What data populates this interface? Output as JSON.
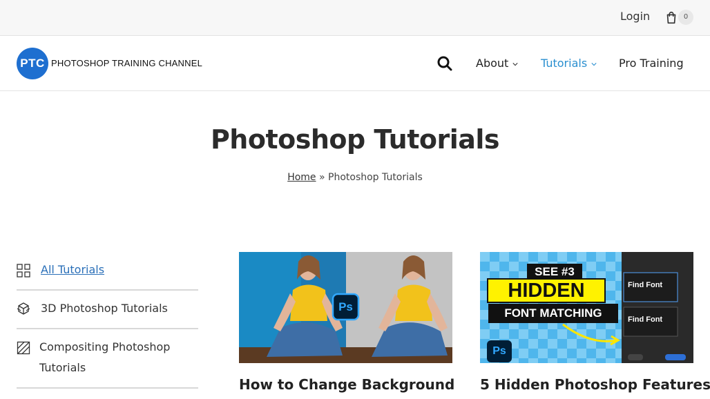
{
  "topbar": {
    "login": "Login",
    "cart_count": "0"
  },
  "header": {
    "logo_mark": "PTC",
    "logo_text": "PHOTOSHOP TRAINING CHANNEL",
    "nav": [
      {
        "label": "About",
        "has_dropdown": true
      },
      {
        "label": "Tutorials",
        "has_dropdown": true,
        "active": true
      },
      {
        "label": "Pro Training",
        "has_dropdown": false
      }
    ]
  },
  "page": {
    "title": "Photoshop Tutorials",
    "breadcrumb_home": "Home",
    "breadcrumb_sep": "»",
    "breadcrumb_current": "Photoshop Tutorials"
  },
  "sidebar": {
    "items": [
      {
        "label": "All Tutorials",
        "icon": "grid-icon",
        "active": true
      },
      {
        "label": "3D Photoshop Tutorials",
        "icon": "cube-icon"
      },
      {
        "label": "Compositing Photoshop Tutorials",
        "icon": "compositing-icon"
      }
    ]
  },
  "cards": [
    {
      "title": "How to Change Background",
      "thumb_badge": "Ps"
    },
    {
      "title": "5 Hidden Photoshop Features",
      "thumb_badge": "Ps",
      "thumb_banner_1": "SEE #3",
      "thumb_banner_2": "HIDDEN",
      "thumb_banner_3": "FONT MATCHING",
      "thumb_panel_1": "Find Font",
      "thumb_panel_2": "Find Font"
    }
  ],
  "colors": {
    "accent": "#2a8fd0",
    "logo_blue": "#1e6fd0",
    "ps_blue": "#31a8ff",
    "ps_dark": "#001e36"
  }
}
